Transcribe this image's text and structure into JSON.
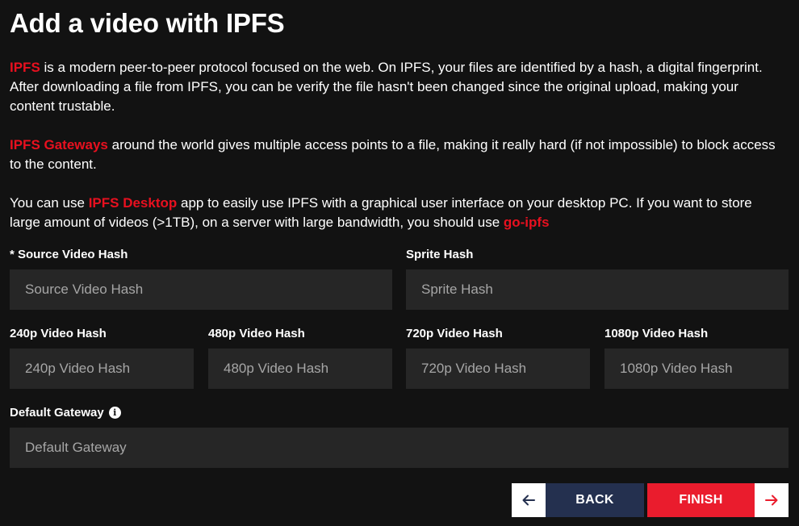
{
  "page": {
    "title": "Add a video with IPFS"
  },
  "intro": {
    "p1": {
      "link": "IPFS",
      "text": " is a modern peer-to-peer protocol focused on the web. On IPFS, your files are identified by a hash, a digital fingerprint. After downloading a file from IPFS, you can be verify the file hasn't been changed since the original upload, making your content trustable."
    },
    "p2": {
      "link": "IPFS Gateways",
      "text": " around the world gives multiple access points to a file, making it really hard (if not impossible) to block access to the content."
    },
    "p3": {
      "text_before": "You can use ",
      "link1": "IPFS Desktop",
      "text_middle": " app to easily use IPFS with a graphical user interface on your desktop PC. If you want to store large amount of videos (>1TB), on a server with large bandwidth, you should use ",
      "link2": "go-ipfs"
    }
  },
  "form": {
    "source_hash": {
      "label": "* Source Video Hash",
      "placeholder": "Source Video Hash",
      "value": ""
    },
    "sprite_hash": {
      "label": "Sprite Hash",
      "placeholder": "Sprite Hash",
      "value": ""
    },
    "hash_240p": {
      "label": "240p Video Hash",
      "placeholder": "240p Video Hash",
      "value": ""
    },
    "hash_480p": {
      "label": "480p Video Hash",
      "placeholder": "480p Video Hash",
      "value": ""
    },
    "hash_720p": {
      "label": "720p Video Hash",
      "placeholder": "720p Video Hash",
      "value": ""
    },
    "hash_1080p": {
      "label": "1080p Video Hash",
      "placeholder": "1080p Video Hash",
      "value": ""
    },
    "gateway": {
      "label": "Default Gateway",
      "placeholder": "Default Gateway",
      "value": "",
      "info_icon": "info-circle-icon"
    }
  },
  "actions": {
    "back": {
      "label": "BACK",
      "icon": "arrow-left-icon"
    },
    "finish": {
      "label": "FINISH",
      "icon": "arrow-right-icon"
    }
  },
  "colors": {
    "background": "#121212",
    "accent_red": "#e8101f",
    "input_bg": "#262626",
    "back_button": "#24304f",
    "finish_button": "#ea1c2d"
  }
}
